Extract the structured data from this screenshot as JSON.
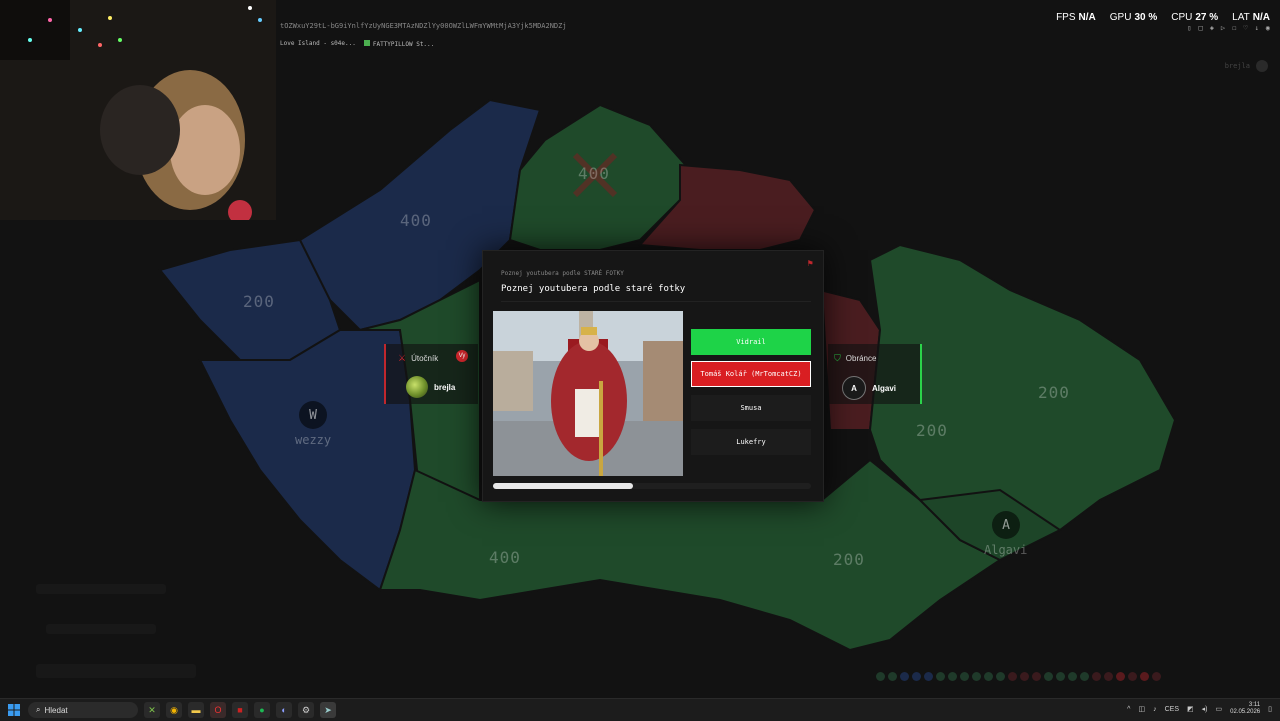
{
  "browser": {
    "url": "tOZWxuY29tL-bG9iYnlfYzUyNGE3MTAzNDZlYy00OWZlLWFmYWMtMjA3Yjk5MDA2NDZj",
    "tabs": [
      "Love Island - s04e...",
      "FATTYPILLOW St..."
    ]
  },
  "perf": [
    {
      "label": "FPS",
      "value": "N/A"
    },
    {
      "label": "GPU",
      "value": "30 %"
    },
    {
      "label": "CPU",
      "value": "27 %"
    },
    {
      "label": "LAT",
      "value": "N/A"
    }
  ],
  "top_user": {
    "name": "brejla"
  },
  "map": {
    "regions": [
      {
        "value": "400"
      },
      {
        "value": "200"
      },
      {
        "value": "400"
      },
      {
        "value": "400"
      },
      {
        "value": "200"
      },
      {
        "value": "200"
      },
      {
        "value": "400"
      },
      {
        "value": "200"
      }
    ],
    "players": [
      {
        "initial": "W",
        "name": "wezzy"
      },
      {
        "initial": "A",
        "name": "Algavi"
      }
    ],
    "colors": {
      "blue": "#1b2a4a",
      "green": "#1f4a2a",
      "red": "#4a1d20",
      "bg": "#121212"
    }
  },
  "attacker": {
    "label": "Útočník",
    "badge": "Vy",
    "player": "brejla"
  },
  "defender": {
    "label": "Obránce",
    "player": "Algavi",
    "initial": "A"
  },
  "question": {
    "category": "Poznej youtubera podle STARÉ FOTKY",
    "text": "Poznej youtubera podle staré fotky",
    "answers": [
      {
        "label": "Vidrail",
        "state": "correct"
      },
      {
        "label": "Tomáš Kolář (MrTomcatCZ)",
        "state": "wrong"
      },
      {
        "label": "Smusa",
        "state": "neutral"
      },
      {
        "label": "Lukefry",
        "state": "neutral"
      }
    ],
    "timer_fraction": 0.44
  },
  "taskbar": {
    "search_placeholder": "Hledat",
    "tray_lang": "CES",
    "time": "3:11",
    "date": "02.05.2026"
  }
}
